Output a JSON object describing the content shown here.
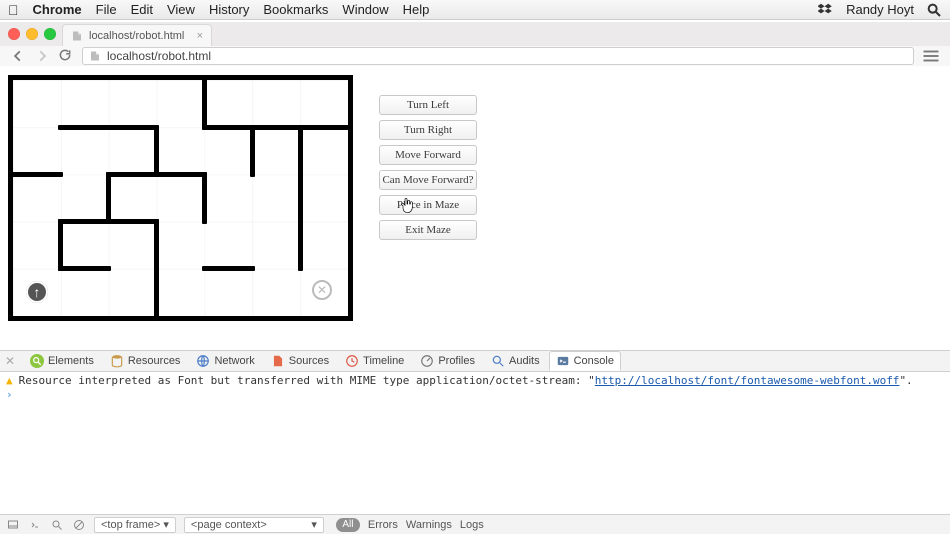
{
  "macmenu": {
    "app": "Chrome",
    "items": [
      "File",
      "Edit",
      "View",
      "History",
      "Bookmarks",
      "Window",
      "Help"
    ],
    "user": "Randy Hoyt"
  },
  "browser": {
    "tab_title": "localhost/robot.html",
    "url": "localhost/robot.html"
  },
  "buttons": {
    "turn_left": "Turn Left",
    "turn_right": "Turn Right",
    "move_forward": "Move Forward",
    "can_move_forward": "Can Move Forward?",
    "place_in_maze": "Place in Maze",
    "exit_maze": "Exit Maze"
  },
  "maze": {
    "cols": 7,
    "rows": 5,
    "robot_cell": {
      "c": 0,
      "r": 4,
      "facing": "up"
    },
    "target_cell": {
      "c": 6,
      "r": 4
    },
    "walls_h": [
      {
        "r": 1,
        "c": 1,
        "len": 2
      },
      {
        "r": 1,
        "c": 4,
        "len": 1
      },
      {
        "r": 1,
        "c": 5,
        "len": 2
      },
      {
        "r": 2,
        "c": 0,
        "len": 1
      },
      {
        "r": 2,
        "c": 2,
        "len": 2
      },
      {
        "r": 3,
        "c": 1,
        "len": 2
      },
      {
        "r": 4,
        "c": 1,
        "len": 1
      },
      {
        "r": 4,
        "c": 4,
        "len": 1
      }
    ],
    "walls_v": [
      {
        "c": 4,
        "r": 0,
        "len": 1
      },
      {
        "c": 3,
        "r": 1,
        "len": 1
      },
      {
        "c": 5,
        "r": 1,
        "len": 1
      },
      {
        "c": 6,
        "r": 1,
        "len": 2
      },
      {
        "c": 2,
        "r": 2,
        "len": 1
      },
      {
        "c": 4,
        "r": 2,
        "len": 1
      },
      {
        "c": 1,
        "r": 3,
        "len": 1
      },
      {
        "c": 3,
        "r": 3,
        "len": 2
      },
      {
        "c": 6,
        "r": 3,
        "len": 1
      }
    ]
  },
  "devtools": {
    "tabs": {
      "elements": "Elements",
      "resources": "Resources",
      "network": "Network",
      "sources": "Sources",
      "timeline": "Timeline",
      "profiles": "Profiles",
      "audits": "Audits",
      "console": "Console"
    },
    "active_tab": "Console",
    "warning_prefix": "Resource interpreted as Font but transferred with MIME type application/octet-stream: \"",
    "warning_url": "http://localhost/font/fontawesome-webfont.woff",
    "warning_suffix": "\".",
    "status": {
      "frame_selector": "<top frame>",
      "context_selector": "<page context>",
      "all": "All",
      "errors": "Errors",
      "warnings": "Warnings",
      "logs": "Logs"
    }
  }
}
